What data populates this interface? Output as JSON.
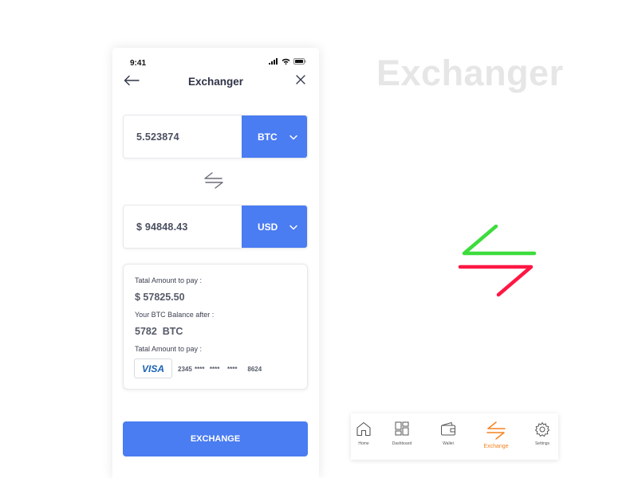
{
  "status_bar": {
    "time": "9:41"
  },
  "header": {
    "title": "Exchanger",
    "back_icon": "arrow-left-icon",
    "close_icon": "close-icon"
  },
  "from": {
    "amount": "5.523874",
    "currency": "BTC"
  },
  "to": {
    "amount": "$ 94848.43",
    "currency": "USD"
  },
  "summary": {
    "total_label": "Tatal Amount to pay :",
    "total_value": "$ 57825.50",
    "balance_label": "Your BTC Balance after :",
    "balance_value": "5782  BTC",
    "pay_label": "Tatal Amount to pay :",
    "card_brand": "VISA",
    "card_number": "2345 ****  ****   ****    8624"
  },
  "exchange_button": "EXCHANGE",
  "showcase": {
    "title": "Exchanger"
  },
  "tabbar": {
    "items": [
      {
        "label": "Home",
        "icon": "home-icon"
      },
      {
        "label": "Dashboard",
        "icon": "dashboard-icon"
      },
      {
        "label": "Wallet",
        "icon": "wallet-icon"
      },
      {
        "label": "Exchange",
        "icon": "exchange-icon",
        "active": true
      },
      {
        "label": "Settings",
        "icon": "gear-icon"
      }
    ]
  },
  "colors": {
    "accent": "#4a7cf2",
    "active_tab": "#f58220",
    "swap_green": "#3ddc3d",
    "swap_red": "#ff1744"
  }
}
